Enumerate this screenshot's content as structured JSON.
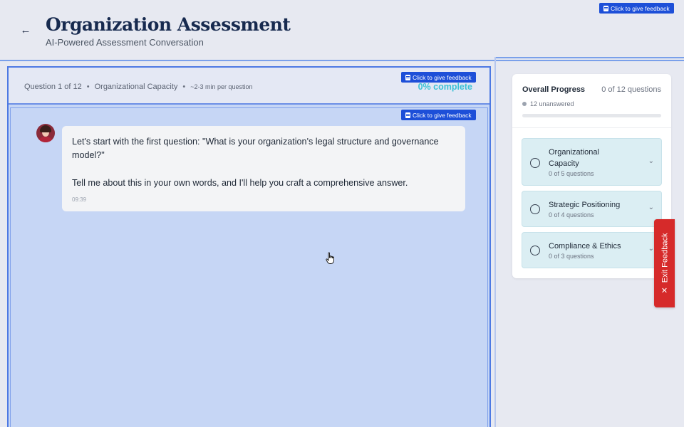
{
  "header": {
    "back_icon": "arrow-left-icon",
    "title": "Organization Assessment",
    "subtitle": "AI-Powered Assessment Conversation"
  },
  "feedback": {
    "label": "Click to give feedback",
    "icon": "feedback-note-icon"
  },
  "question_bar": {
    "position": "Question 1 of 12",
    "separator": "•",
    "category": "Organizational Capacity",
    "time_estimate": "~2-3 min per question",
    "percent_label": "0% complete"
  },
  "chat": {
    "avatar": "assistant-avatar",
    "message_line1": "Let's start with the first question: \"What is your organization's legal structure and governance model?\"",
    "message_line2": "Tell me about this in your own words, and I'll help you craft a comprehensive answer.",
    "timestamp": "09:39"
  },
  "progress": {
    "title": "Overall Progress",
    "count": "0 of 12 questions",
    "unanswered": "12 unanswered",
    "fraction": 0,
    "sections": [
      {
        "name": "Organizational Capacity",
        "count": "0 of 5 questions"
      },
      {
        "name": "Strategic Positioning",
        "count": "0 of 4 questions"
      },
      {
        "name": "Compliance & Ethics",
        "count": "0 of 3 questions"
      }
    ]
  },
  "exit_feedback": {
    "icon": "close-x-icon",
    "label": "Exit Feedback"
  },
  "colors": {
    "accent": "#3cc1d6",
    "brand_blue": "#1d4fd8",
    "exit_red": "#d62a2a",
    "title_navy": "#172a4f"
  }
}
